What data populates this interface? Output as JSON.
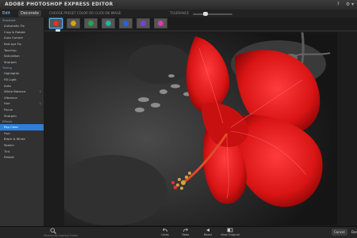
{
  "app": {
    "title": "ADOBE PHOTOSHOP EXPRESS EDITOR",
    "window_buttons": [
      "?",
      "⚙ ▾"
    ]
  },
  "tabs": {
    "edit": "Edit",
    "decorate": "Decorate"
  },
  "effect_options": {
    "label": "CHOOSE PRESET COLOR OR CLICK ON IMAGE",
    "mode_label": "TOLERANCE",
    "swatch_colors": [
      "#ffffff",
      "#e23b3b",
      "#3fb43f",
      "#3a6fe0",
      "#222222"
    ],
    "tolerance_level": 0.3
  },
  "thumbnails": {
    "colors": [
      "#e23030",
      "#d7a21a",
      "#2aa34a",
      "#1fb7a4",
      "#2463e0",
      "#7b3fe0",
      "#e03ab0"
    ],
    "selected_index": 0
  },
  "sidebar": {
    "sections": [
      {
        "title": "Standard",
        "items": [
          {
            "label": "Automatic Fix"
          },
          {
            "label": "Crop & Rotate"
          },
          {
            "label": "Auto Correct"
          },
          {
            "label": "Red-eye Fix"
          },
          {
            "label": "Touchup"
          },
          {
            "label": "Saturation"
          },
          {
            "label": "Sharpen"
          }
        ]
      },
      {
        "title": "Tuning",
        "items": [
          {
            "label": "Highlights"
          },
          {
            "label": "Fill Light"
          },
          {
            "label": "Auto"
          },
          {
            "label": "White Balance",
            "count": "1"
          },
          {
            "label": "Vibrance"
          },
          {
            "label": "Hue",
            "count": "1"
          },
          {
            "label": "Focus"
          },
          {
            "label": "Sharpen"
          }
        ]
      },
      {
        "title": "Effects",
        "items": [
          {
            "label": "Pop Color"
          },
          {
            "label": "Hue"
          },
          {
            "label": "Black & White"
          },
          {
            "label": "Sketch"
          },
          {
            "label": "Tint"
          },
          {
            "label": "Distort"
          }
        ]
      }
    ],
    "pop_color_label": "Pop Color"
  },
  "bottom_toolbar": {
    "tools": [
      "Undo",
      "Redo",
      "Reset",
      "View Original"
    ],
    "cancel": "Cancel",
    "done": "Done",
    "status": "Photoshop Express Editor"
  }
}
